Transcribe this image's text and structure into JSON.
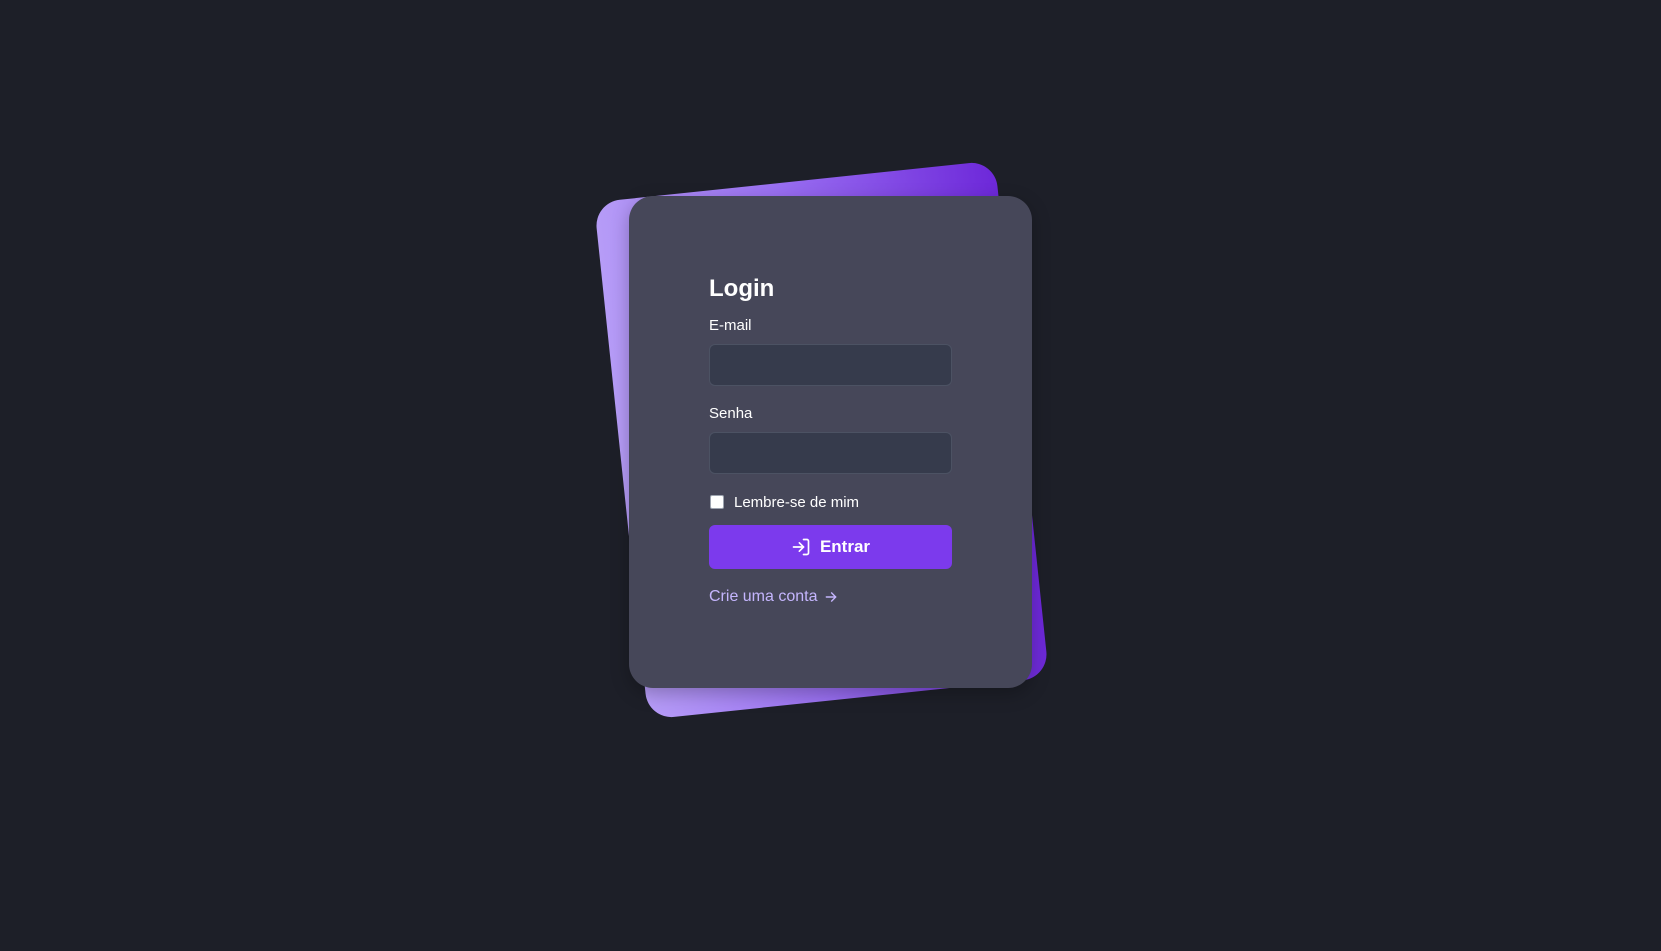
{
  "login": {
    "title": "Login",
    "email_label": "E-mail",
    "email_value": "",
    "password_label": "Senha",
    "password_value": "",
    "remember_label": "Lembre-se de mim",
    "remember_checked": false,
    "submit_label": "Entrar",
    "submit_icon": "login-arrow-icon",
    "create_account_label": "Crie uma conta",
    "create_account_icon": "arrow-right-icon"
  },
  "colors": {
    "background": "#1d1f28",
    "card": "#464759",
    "input": "#363b4c",
    "accent": "#7c3aed",
    "link": "#c4b5fd",
    "backdrop_light": "#b69cf7",
    "backdrop_dark": "#6d28d9"
  }
}
